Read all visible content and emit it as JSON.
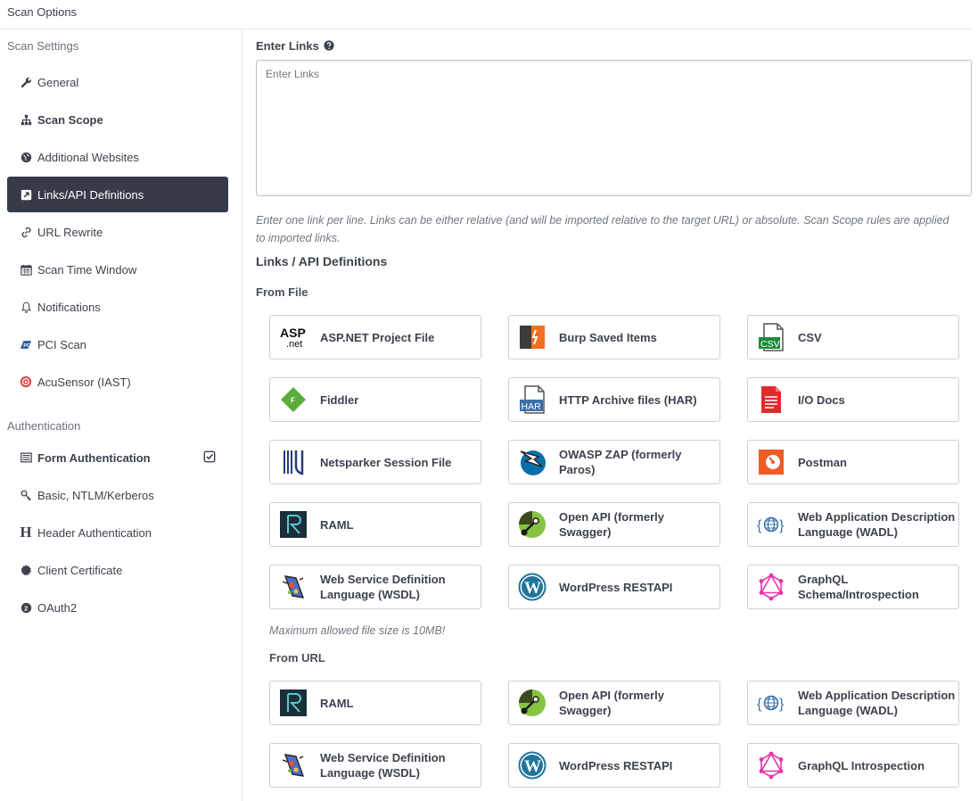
{
  "header": {
    "title": "Scan Options"
  },
  "sidebar": {
    "settings_heading": "Scan Settings",
    "settings_items": [
      {
        "label": "General",
        "icon": "wrench-icon"
      },
      {
        "label": "Scan Scope",
        "icon": "sitemap-icon"
      },
      {
        "label": "Additional Websites",
        "icon": "globe-icon"
      },
      {
        "label": "Links/API Definitions",
        "icon": "external-link-icon"
      },
      {
        "label": "URL Rewrite",
        "icon": "link-icon"
      },
      {
        "label": "Scan Time Window",
        "icon": "calendar-icon"
      },
      {
        "label": "Notifications",
        "icon": "bell-icon"
      },
      {
        "label": "PCI Scan",
        "icon": "pci-icon"
      },
      {
        "label": "AcuSensor (IAST)",
        "icon": "acusensor-icon"
      }
    ],
    "auth_heading": "Authentication",
    "auth_items": [
      {
        "label": "Form Authentication",
        "icon": "form-icon"
      },
      {
        "label": "Basic, NTLM/Kerberos",
        "icon": "key-icon"
      },
      {
        "label": "Header Authentication",
        "icon": "header-h-icon"
      },
      {
        "label": "Client Certificate",
        "icon": "certificate-icon"
      },
      {
        "label": "OAuth2",
        "icon": "oauth2-icon"
      }
    ]
  },
  "main": {
    "enter_links_label": "Enter Links",
    "enter_links_placeholder": "Enter Links",
    "help_text": "Enter one link per line. Links can be either relative (and will be imported relative to the target URL) or absolute. Scan Scope rules are applied to imported links.",
    "section_title": "Links / API Definitions",
    "from_file_label": "From File",
    "from_file": [
      {
        "label": "ASP.NET Project File",
        "icon": "aspnet-icon"
      },
      {
        "label": "Burp Saved Items",
        "icon": "burp-icon"
      },
      {
        "label": "CSV",
        "icon": "csv-icon"
      },
      {
        "label": "Fiddler",
        "icon": "fiddler-icon"
      },
      {
        "label": "HTTP Archive files (HAR)",
        "icon": "har-icon"
      },
      {
        "label": "I/O Docs",
        "icon": "iodocs-icon"
      },
      {
        "label": "Netsparker Session File",
        "icon": "netsparker-icon"
      },
      {
        "label": "OWASP ZAP (formerly Paros)",
        "icon": "zap-icon"
      },
      {
        "label": "Postman",
        "icon": "postman-icon"
      },
      {
        "label": "RAML",
        "icon": "raml-icon"
      },
      {
        "label": "Open API (formerly Swagger)",
        "icon": "openapi-icon"
      },
      {
        "label": "Web Application Description Language (WADL)",
        "icon": "wadl-icon"
      },
      {
        "label": "Web Service Definition Language (WSDL)",
        "icon": "wsdl-icon"
      },
      {
        "label": "WordPress RESTAPI",
        "icon": "wordpress-icon"
      },
      {
        "label": "GraphQL Schema/Introspection",
        "icon": "graphql-icon"
      }
    ],
    "file_size_note": "Maximum allowed file size is 10MB!",
    "from_url_label": "From URL",
    "from_url": [
      {
        "label": "RAML",
        "icon": "raml-icon"
      },
      {
        "label": "Open API (formerly Swagger)",
        "icon": "openapi-icon"
      },
      {
        "label": "Web Application Description Language (WADL)",
        "icon": "wadl-icon"
      },
      {
        "label": "Web Service Definition Language (WSDL)",
        "icon": "wsdl-icon"
      },
      {
        "label": "WordPress RESTAPI",
        "icon": "wordpress-icon"
      },
      {
        "label": "GraphQL Introspection",
        "icon": "graphql-icon"
      }
    ]
  }
}
